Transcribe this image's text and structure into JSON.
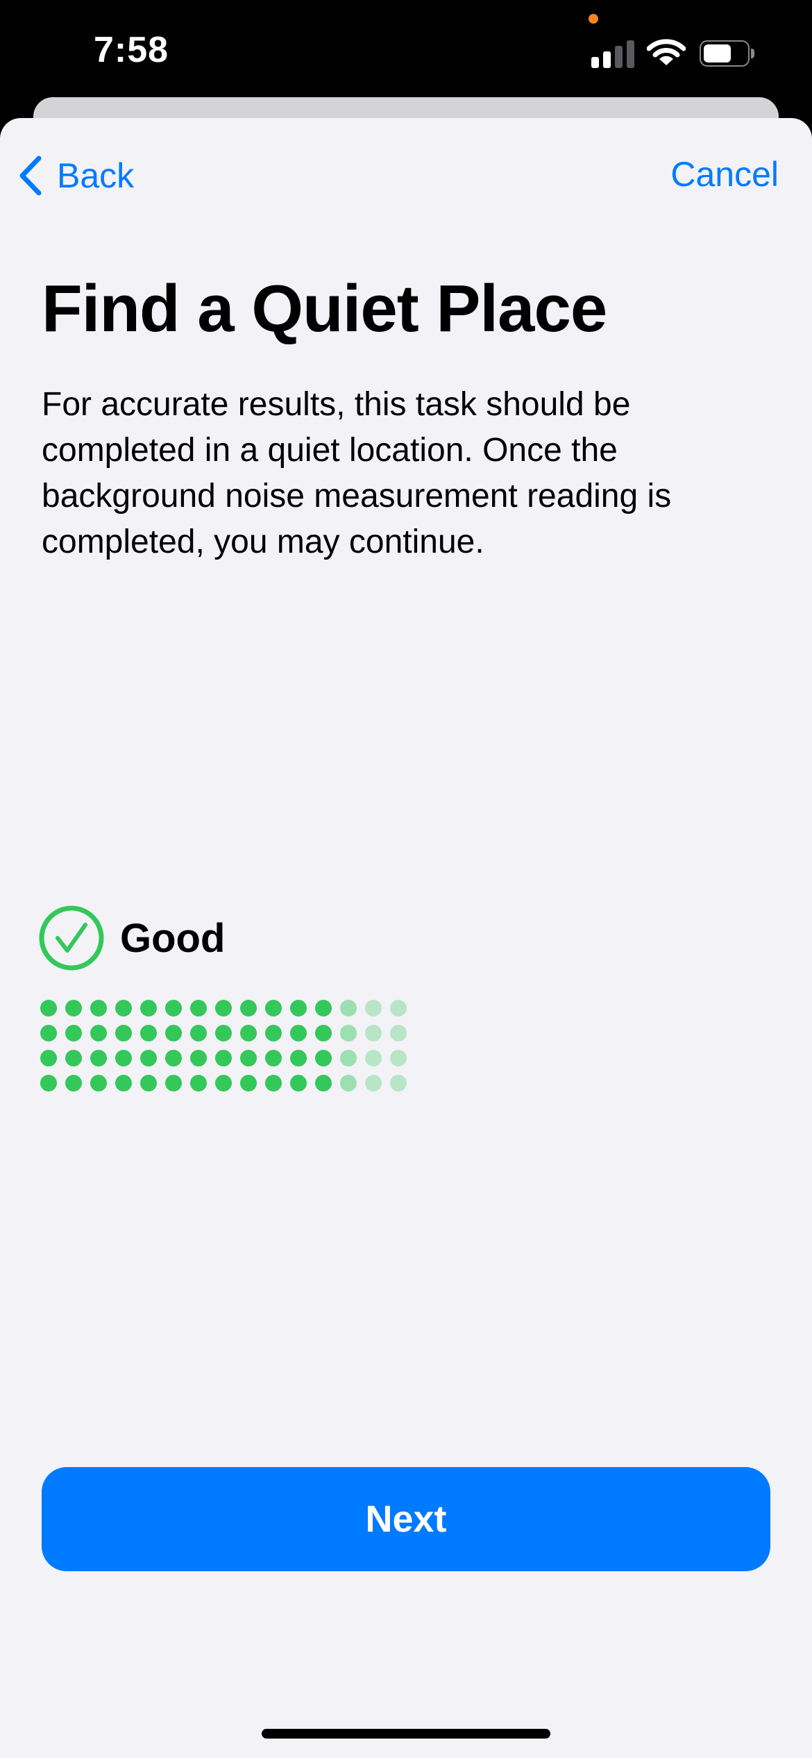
{
  "status_bar": {
    "time": "7:58",
    "privacy_indicator_color": "#f7851d",
    "signal_bars_active": 2,
    "signal_bars_total": 4,
    "battery_level": 0.7
  },
  "nav": {
    "back_label": "Back",
    "cancel_label": "Cancel"
  },
  "content": {
    "title": "Find a Quiet Place",
    "description": "For accurate results, this task should be completed in a quiet location. Once the background noise measurement reading is completed, you may continue."
  },
  "noise_status": {
    "label": "Good",
    "icon": "checkmark-circle-icon",
    "meter": {
      "rows": 4,
      "columns": 15,
      "active_columns": 12,
      "level": 0.8
    }
  },
  "actions": {
    "next_label": "Next"
  },
  "colors": {
    "accent": "#007aff",
    "success": "#34c759",
    "background": "#f2f2f7"
  }
}
